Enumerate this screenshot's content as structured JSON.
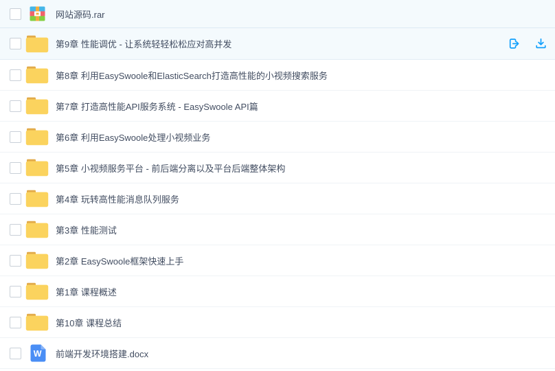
{
  "list": {
    "rows": [
      {
        "name": "网站源码.rar",
        "icon": "rar",
        "selected": false
      },
      {
        "name": "第9章 性能调优 - 让系统轻轻松松应对高并发",
        "icon": "folder",
        "selected": true,
        "actions": [
          "share",
          "download"
        ]
      },
      {
        "name": "第8章 利用EasySwoole和ElasticSearch打造高性能的小视频搜索服务",
        "icon": "folder",
        "selected": false
      },
      {
        "name": "第7章 打造高性能API服务系统 - EasySwoole API篇",
        "icon": "folder",
        "selected": false
      },
      {
        "name": "第6章 利用EasySwoole处理小视频业务",
        "icon": "folder",
        "selected": false
      },
      {
        "name": "第5章 小视频服务平台 - 前后端分离以及平台后端整体架构",
        "icon": "folder",
        "selected": false
      },
      {
        "name": "第4章 玩转高性能消息队列服务",
        "icon": "folder",
        "selected": false
      },
      {
        "name": "第3章 性能测试",
        "icon": "folder",
        "selected": false
      },
      {
        "name": "第2章 EasySwoole框架快速上手",
        "icon": "folder",
        "selected": false
      },
      {
        "name": "第1章 课程概述",
        "icon": "folder",
        "selected": false
      },
      {
        "name": "第10章 课程总结",
        "icon": "folder",
        "selected": false
      },
      {
        "name": "前端开发环境搭建.docx",
        "icon": "word",
        "selected": false
      }
    ],
    "icon_names": {
      "rar": "rar-archive-icon",
      "folder": "folder-icon",
      "word": "word-document-icon"
    },
    "colors": {
      "accent": "#12a0fc",
      "row_selected_bg": "#f4fafd",
      "text": "#424d61",
      "folder_body": "#fbd35e",
      "folder_tab": "#e2ab4a",
      "rar_blue": "#45b6e8",
      "rar_red": "#f2636c",
      "rar_green": "#84cf41",
      "rar_strap": "#f3ad3d",
      "word_blue": "#4a8ef5",
      "word_fold": "#8ab5f8"
    }
  }
}
